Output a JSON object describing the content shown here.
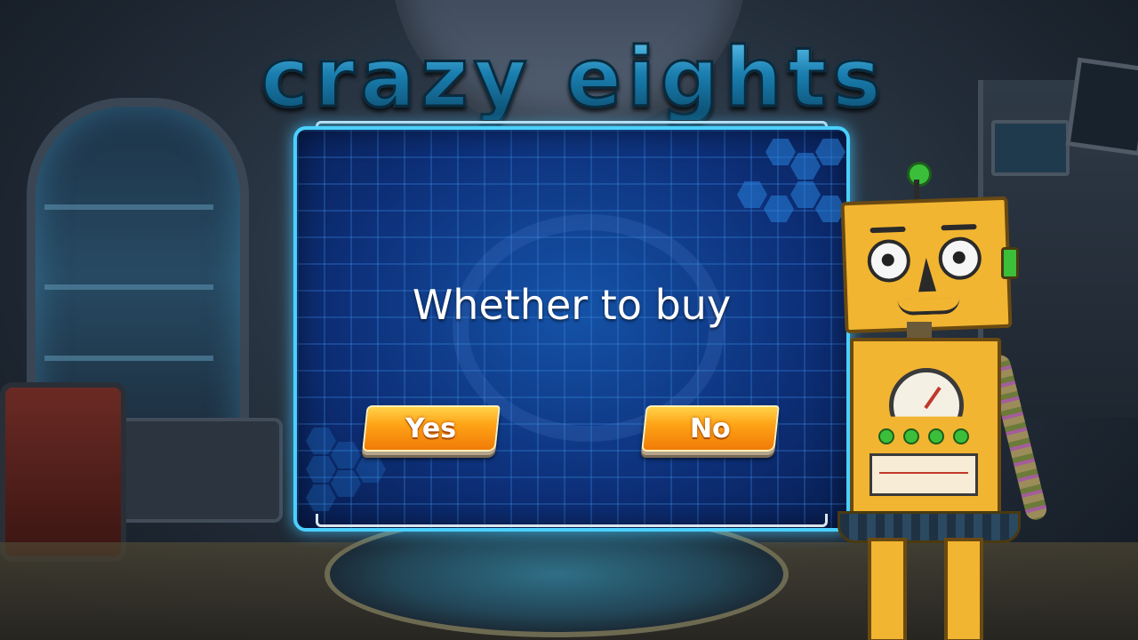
{
  "game": {
    "title": "crazy eights"
  },
  "dialog": {
    "message": "Whether to buy",
    "buttons": {
      "yes_label": "Yes",
      "no_label": "No"
    }
  },
  "colors": {
    "dialog_border": "#4ad0ff",
    "dialog_fill": "#0d2f78",
    "button_orange": "#ffa417",
    "logo_blue": "#1a7fb0"
  },
  "icons": {
    "background": "lab-room",
    "mascot": "yellow-robot",
    "dialog_emblem": "eagle-shield-emblem"
  }
}
